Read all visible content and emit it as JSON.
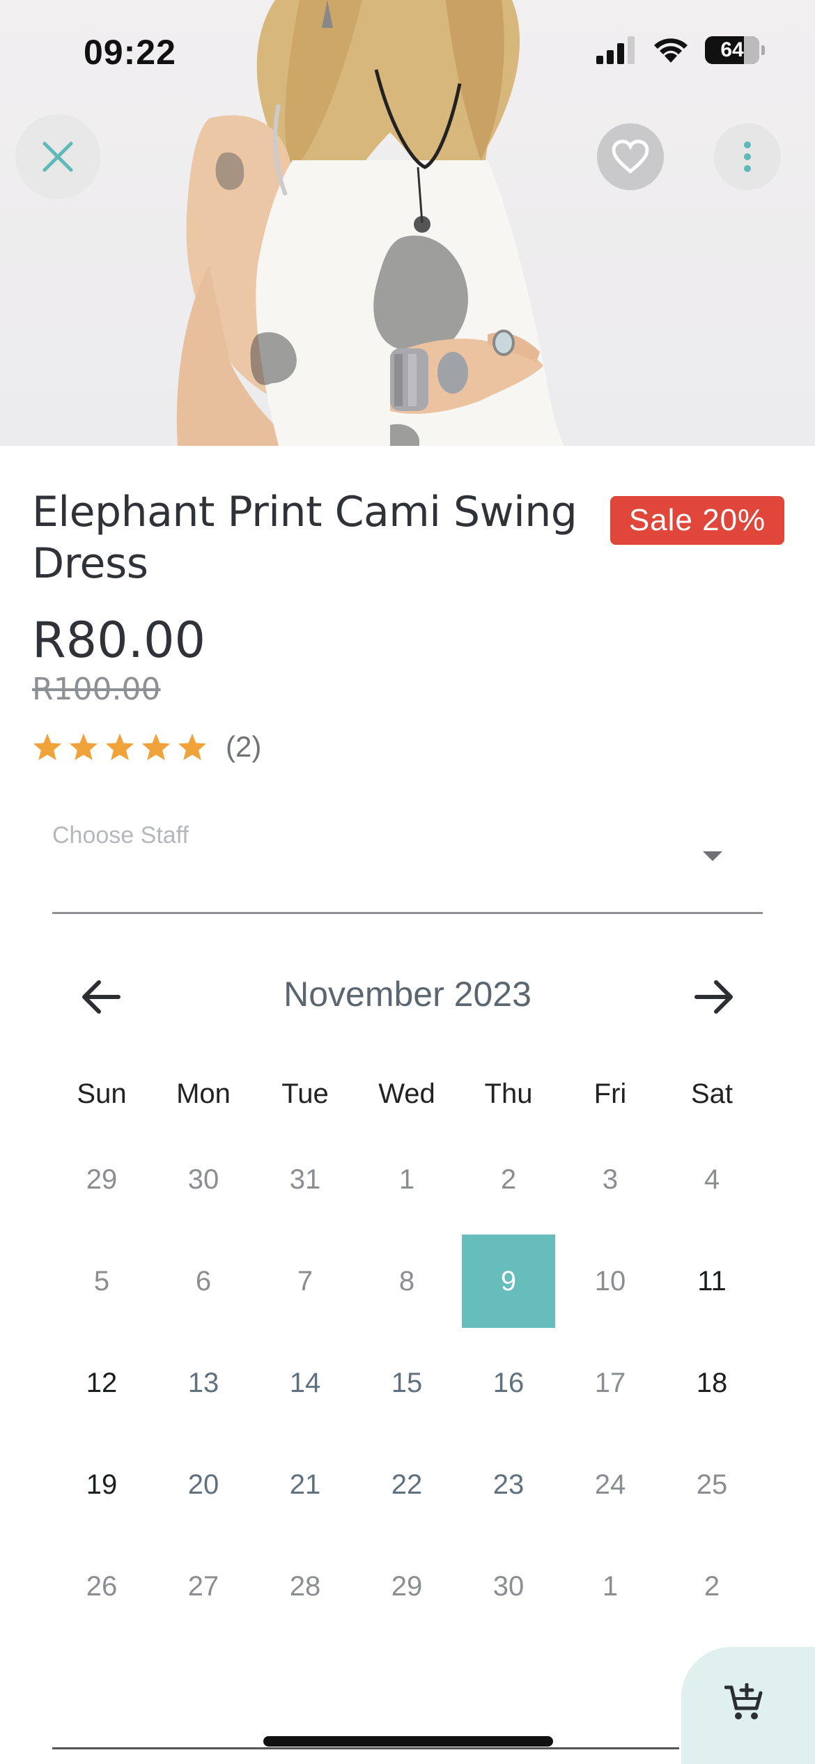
{
  "status_bar": {
    "time": "09:22",
    "battery": "64"
  },
  "hero": {
    "image_alt": "Model wearing elephant print cami swing dress"
  },
  "overlay_buttons": {
    "close_icon": "close-icon",
    "favorite_icon": "heart-icon",
    "more_icon": "more-vertical-icon"
  },
  "product": {
    "title": "Elephant Print Cami Swing Dress",
    "sale_badge": "Sale 20%",
    "price": "R80.00",
    "old_price": "R100.00",
    "rating": {
      "stars": 5,
      "count": "(2)"
    }
  },
  "staff_select": {
    "label": "Choose Staff",
    "value": ""
  },
  "calendar": {
    "month": "November 2023",
    "weekdays": [
      "Sun",
      "Mon",
      "Tue",
      "Wed",
      "Thu",
      "Fri",
      "Sat"
    ],
    "days": [
      "29",
      "30",
      "31",
      "1",
      "2",
      "3",
      "4",
      "5",
      "6",
      "7",
      "8",
      "9",
      "10",
      "11",
      "12",
      "13",
      "14",
      "15",
      "16",
      "17",
      "18",
      "19",
      "20",
      "21",
      "22",
      "23",
      "24",
      "25",
      "26",
      "27",
      "28",
      "29",
      "30",
      "1",
      "2"
    ],
    "selected": "9"
  },
  "colors": {
    "accent": "#66bdbc",
    "sale": "#e0473a",
    "star": "#f0a23b",
    "cart_bg": "#dff0ef"
  },
  "fab": {
    "icon": "add-to-cart-icon"
  }
}
